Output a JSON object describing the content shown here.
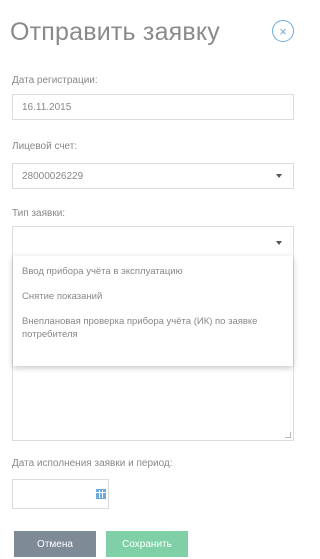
{
  "modal": {
    "title": "Отправить заявку",
    "close_symbol": "×"
  },
  "form": {
    "registration_date": {
      "label": "Дата регистрации:",
      "value": "16.11.2015"
    },
    "personal_account": {
      "label": "Лицевой счет:",
      "value": "28000026229"
    },
    "request_type": {
      "label": "Тип заявки:",
      "value": "",
      "options": [
        "Ввод прибора учёта в эксплуатацию",
        "Снятие показаний",
        "Внеплановая проверка прибора учёта (ИК) по заявке потребителя"
      ]
    },
    "execution_date": {
      "label": "Дата исполнения заявки и период:",
      "value": ""
    }
  },
  "buttons": {
    "cancel": "Отмена",
    "save": "Сохранить"
  },
  "icons": {
    "close": "close-icon",
    "dropdown": "chevron-down-icon",
    "calendar": "calendar-icon"
  },
  "colors": {
    "accent": "#6ea9da",
    "cancel_bg": "#7f8a97",
    "save_bg": "#7fd0a6"
  }
}
